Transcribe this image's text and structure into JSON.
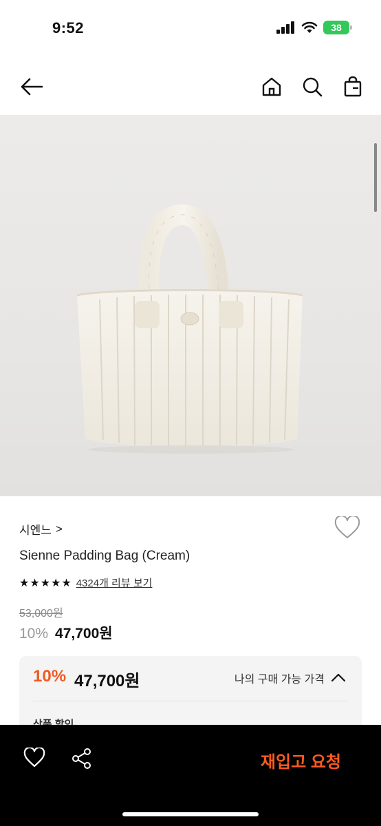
{
  "status_bar": {
    "time": "9:52",
    "battery": "38"
  },
  "header": {
    "back_icon": "arrow-left-icon",
    "home_icon": "home-icon",
    "search_icon": "search-icon",
    "cart_icon": "shopping-bag-icon"
  },
  "product": {
    "brand": "시엔느",
    "brand_chevron": ">",
    "name": "Sienne Padding Bag (Cream)",
    "stars": "★★★★★",
    "review_link": "4324개 리뷰 보기",
    "original_price": "53,000원",
    "discount": "10%",
    "price": "47,700원"
  },
  "benefit_box": {
    "discount": "10%",
    "price": "47,700원",
    "label": "나의 구매 가능 가격",
    "sub_label": "상품 할인"
  },
  "bottom_bar": {
    "restock_label": "재입고 요청",
    "like_icon": "heart-icon",
    "share_icon": "share-icon"
  },
  "colors": {
    "accent": "#f05a22",
    "restock": "#ff5a1f",
    "battery": "#34c759"
  }
}
